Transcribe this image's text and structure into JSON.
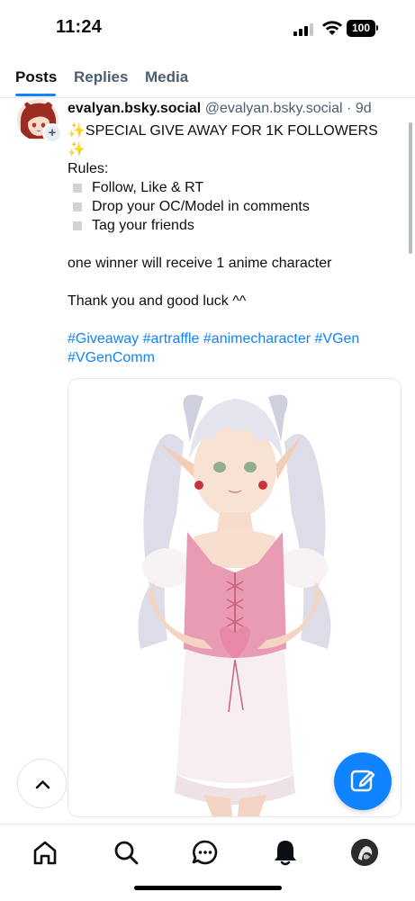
{
  "status_bar": {
    "time": "11:24",
    "battery": "100"
  },
  "tabs": [
    {
      "label": "Posts",
      "active": true
    },
    {
      "label": "Replies",
      "active": false
    },
    {
      "label": "Media",
      "active": false
    }
  ],
  "post": {
    "display_name": "evalyan.bsky.social",
    "handle": "@evalyan.bsky.social",
    "age": "· 9d",
    "title_line1": "SPECIAL GIVE AWAY FOR 1K FOLLOWERS",
    "sparkle": "✨",
    "rules_label": "Rules:",
    "rules": [
      "Follow, Like & RT",
      "Drop your OC/Model  in comments",
      "Tag your friends"
    ],
    "winner_text": "one winner will receive 1 anime character",
    "thanks_text": "Thank you and good luck ^^",
    "hashtags_line1": "#Giveaway #artraffle #animecharacter #VGen",
    "hashtags_line2": "#VGenComm"
  },
  "colors": {
    "accent": "#1083fe",
    "text_primary": "#0b0f14",
    "text_secondary": "#4d5e70",
    "divider": "#e3e8ee"
  },
  "icons": {
    "scroll_top": "chevron-up-icon",
    "compose": "compose-icon",
    "nav": [
      "home-icon",
      "search-icon",
      "chat-icon",
      "bell-icon",
      "profile-avatar"
    ]
  }
}
